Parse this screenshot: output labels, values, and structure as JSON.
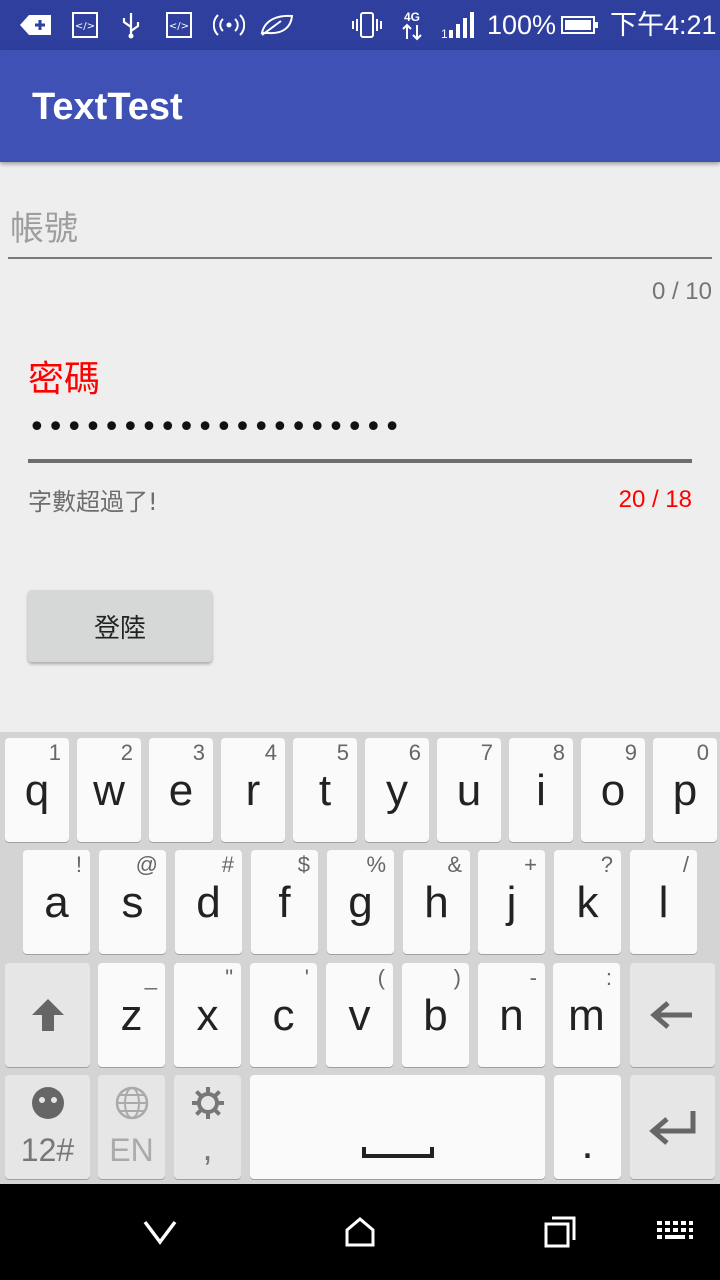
{
  "status_bar": {
    "battery_percent": "100%",
    "time": "下午4:21",
    "network": "4G",
    "icons": [
      "add-icon",
      "code-icon",
      "usb-icon",
      "code-icon",
      "hotspot-icon",
      "leaf-icon",
      "vibrate-icon",
      "4g-icon",
      "signal-icon",
      "battery-icon"
    ]
  },
  "app_bar": {
    "title": "TextTest"
  },
  "form": {
    "account": {
      "placeholder": "帳號",
      "value": "",
      "counter": "0 / 10"
    },
    "password": {
      "label": "密碼",
      "value": "••••••••••••••••••••",
      "error": "字數超過了!",
      "counter": "20 / 18"
    },
    "login_button": "登陸"
  },
  "colors": {
    "primary": "#3f51b5",
    "primary_dark": "#2f3f9e",
    "error": "#ff0000"
  },
  "keyboard": {
    "row1": [
      {
        "k": "q",
        "h": "1"
      },
      {
        "k": "w",
        "h": "2"
      },
      {
        "k": "e",
        "h": "3"
      },
      {
        "k": "r",
        "h": "4"
      },
      {
        "k": "t",
        "h": "5"
      },
      {
        "k": "y",
        "h": "6"
      },
      {
        "k": "u",
        "h": "7"
      },
      {
        "k": "i",
        "h": "8"
      },
      {
        "k": "o",
        "h": "9"
      },
      {
        "k": "p",
        "h": "0"
      }
    ],
    "row2": [
      {
        "k": "a",
        "h": "!"
      },
      {
        "k": "s",
        "h": "@"
      },
      {
        "k": "d",
        "h": "#"
      },
      {
        "k": "f",
        "h": "$"
      },
      {
        "k": "g",
        "h": "%"
      },
      {
        "k": "h",
        "h": "&"
      },
      {
        "k": "j",
        "h": "+"
      },
      {
        "k": "k",
        "h": "?"
      },
      {
        "k": "l",
        "h": "/"
      }
    ],
    "row3": [
      {
        "k": "z",
        "h": "_"
      },
      {
        "k": "x",
        "h": "\""
      },
      {
        "k": "c",
        "h": "'"
      },
      {
        "k": "v",
        "h": "("
      },
      {
        "k": "b",
        "h": ")"
      },
      {
        "k": "n",
        "h": "-"
      },
      {
        "k": "m",
        "h": ":"
      }
    ],
    "symbols_label": "12#",
    "language_label": "EN",
    "comma_label": ",",
    "period_label": "."
  }
}
